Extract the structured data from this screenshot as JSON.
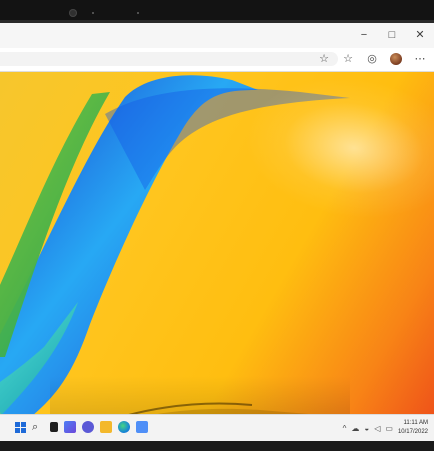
{
  "window": {
    "controls": {
      "minimize": "−",
      "maximize": "□",
      "close": "✕"
    }
  },
  "toolbar": {
    "icons": [
      {
        "name": "favorites-icon",
        "glyph": "☆"
      },
      {
        "name": "star-icon",
        "glyph": "☆"
      },
      {
        "name": "extensions-icon",
        "glyph": "◎"
      },
      {
        "name": "profile-icon",
        "glyph": ""
      },
      {
        "name": "more-icon",
        "glyph": "⋯"
      }
    ]
  },
  "taskbar": {
    "apps": [
      {
        "name": "start-button",
        "type": "windows"
      },
      {
        "name": "search-icon",
        "glyph": "⌕"
      },
      {
        "name": "task-view-icon",
        "glyph": "▤"
      },
      {
        "name": "widgets-icon",
        "glyph": "◫"
      },
      {
        "name": "chat-icon",
        "glyph": "◉"
      },
      {
        "name": "file-explorer-icon",
        "glyph": "■"
      },
      {
        "name": "edge-icon",
        "glyph": "◌"
      },
      {
        "name": "store-icon",
        "glyph": "■"
      }
    ],
    "tray": {
      "chevron": "^",
      "clock_time": "11:11 AM",
      "clock_date": "10/17/2022"
    }
  },
  "colors": {
    "accent_blue": "#1e6ad8",
    "taskbar_bg": "#f3f3f3",
    "wallpaper_yellow": "#ffc51e",
    "wallpaper_orange": "#f88416"
  }
}
